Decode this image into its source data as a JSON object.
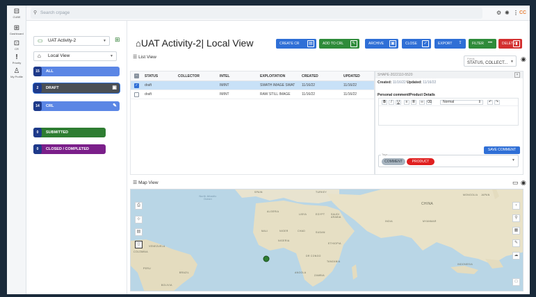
{
  "rail": [
    {
      "icon": "⊟",
      "label": "CUBE"
    },
    {
      "icon": "⊞",
      "label": "Dashboard"
    },
    {
      "icon": "⊡",
      "label": "CR"
    },
    {
      "icon": "!",
      "label": "Priority"
    },
    {
      "icon": "♙",
      "label": "My Profile"
    }
  ],
  "topbar": {
    "search_placeholder": "Search crpage",
    "avatar_initials": "CC"
  },
  "left": {
    "activity_select": "UAT Activity-2",
    "view_select": "Local View",
    "filters": [
      {
        "count": "15",
        "label": "ALL",
        "color": "#5b86e5"
      },
      {
        "count": "2",
        "label": "DRAFT",
        "color": "#4a4f55"
      },
      {
        "count": "14",
        "label": "CRL",
        "color": "#5b86e5"
      },
      {
        "count": "0",
        "label": "SUBMITTED",
        "color": "#2e7d32"
      },
      {
        "count": "0",
        "label": "CLOSED / COMPLETED",
        "color": "#7b1f8a"
      }
    ]
  },
  "header": {
    "title": "UAT Activity-2| Local View",
    "buttons": [
      {
        "label": "CREATE CR",
        "color": "#2f6fd6",
        "icon": "▤"
      },
      {
        "label": "ADD TO CRL",
        "color": "#2e8b3a",
        "icon": "✎"
      },
      {
        "label": "ARCHIVE",
        "color": "#2f6fd6",
        "icon": "▣"
      },
      {
        "label": "CLOSE",
        "color": "#2f6fd6",
        "icon": "✓"
      },
      {
        "label": "EXPORT",
        "color": "#2f6fd6",
        "icon": "⇪"
      },
      {
        "label": "FILTER",
        "color": "#2e8b3a",
        "icon": "•••"
      },
      {
        "label": "DELETE",
        "color": "#d32f2f",
        "icon": "▮"
      }
    ]
  },
  "listview": {
    "label": "List View",
    "fields_label": "Fields",
    "fields_value": "STATUS, COLLECT...",
    "columns": [
      "STATUS",
      "COLLECTOR",
      "INTEL",
      "EXPLOITATION",
      "CREATED",
      "UPDATED"
    ],
    "rows": [
      {
        "status": "draft",
        "collector": "",
        "intel": "IMINT",
        "exploitation": "SWATH IMAGE SWAT",
        "created": "11/16/22",
        "updated": "11/16/22",
        "selected": true
      },
      {
        "status": "draft",
        "collector": "",
        "intel": "IMINT",
        "exploitation": "RAW STILL IMAGE",
        "created": "11/16/22",
        "updated": "11/16/22",
        "selected": false
      }
    ]
  },
  "detail": {
    "header": "SHAPE-2022110-5520",
    "created_label": "Created:",
    "created": "11/16/22",
    "updated_label": "Updated:",
    "updated": "11/16/22",
    "comment_label": "Personal comment/Product Details",
    "format": "Normal",
    "save_label": "SAVE COMMENT",
    "tags_label": "Tags",
    "chips": [
      {
        "label": "COMMENT",
        "bg": "#a7b4bf",
        "fg": "#2d3a45"
      },
      {
        "label": "PRODUCT",
        "bg": "#e02020",
        "fg": "#ffffff"
      }
    ]
  },
  "map": {
    "label": "Map View",
    "labels": [
      {
        "text": "SPAIN",
        "cls": ""
      },
      {
        "text": "TURKEY",
        "cls": ""
      },
      {
        "text": "North Atlantic Ocean",
        "cls": "ocean"
      },
      {
        "text": "ALGERIA",
        "cls": ""
      },
      {
        "text": "LIBYA",
        "cls": ""
      },
      {
        "text": "EGYPT",
        "cls": ""
      },
      {
        "text": "SAUDI ARABIA",
        "cls": ""
      },
      {
        "text": "MALI",
        "cls": ""
      },
      {
        "text": "NIGER",
        "cls": ""
      },
      {
        "text": "CHAD",
        "cls": ""
      },
      {
        "text": "SUDAN",
        "cls": ""
      },
      {
        "text": "NIGERIA",
        "cls": ""
      },
      {
        "text": "ETHIOPIA",
        "cls": ""
      },
      {
        "text": "DR CONGO",
        "cls": ""
      },
      {
        "text": "TANZANIA",
        "cls": ""
      },
      {
        "text": "ANGOLA",
        "cls": ""
      },
      {
        "text": "ZAMBIA",
        "cls": ""
      },
      {
        "text": "BRAZIL",
        "cls": ""
      },
      {
        "text": "PERU",
        "cls": ""
      },
      {
        "text": "COLOMBIA",
        "cls": ""
      },
      {
        "text": "VENEZUELA",
        "cls": ""
      },
      {
        "text": "BOLIVIA",
        "cls": ""
      },
      {
        "text": "CHINA",
        "cls": ""
      },
      {
        "text": "INDIA",
        "cls": ""
      },
      {
        "text": "MYANMAR",
        "cls": ""
      },
      {
        "text": "MONGOLIA",
        "cls": ""
      },
      {
        "text": "JAPAN",
        "cls": ""
      },
      {
        "text": "INDONESIA",
        "cls": ""
      }
    ]
  }
}
